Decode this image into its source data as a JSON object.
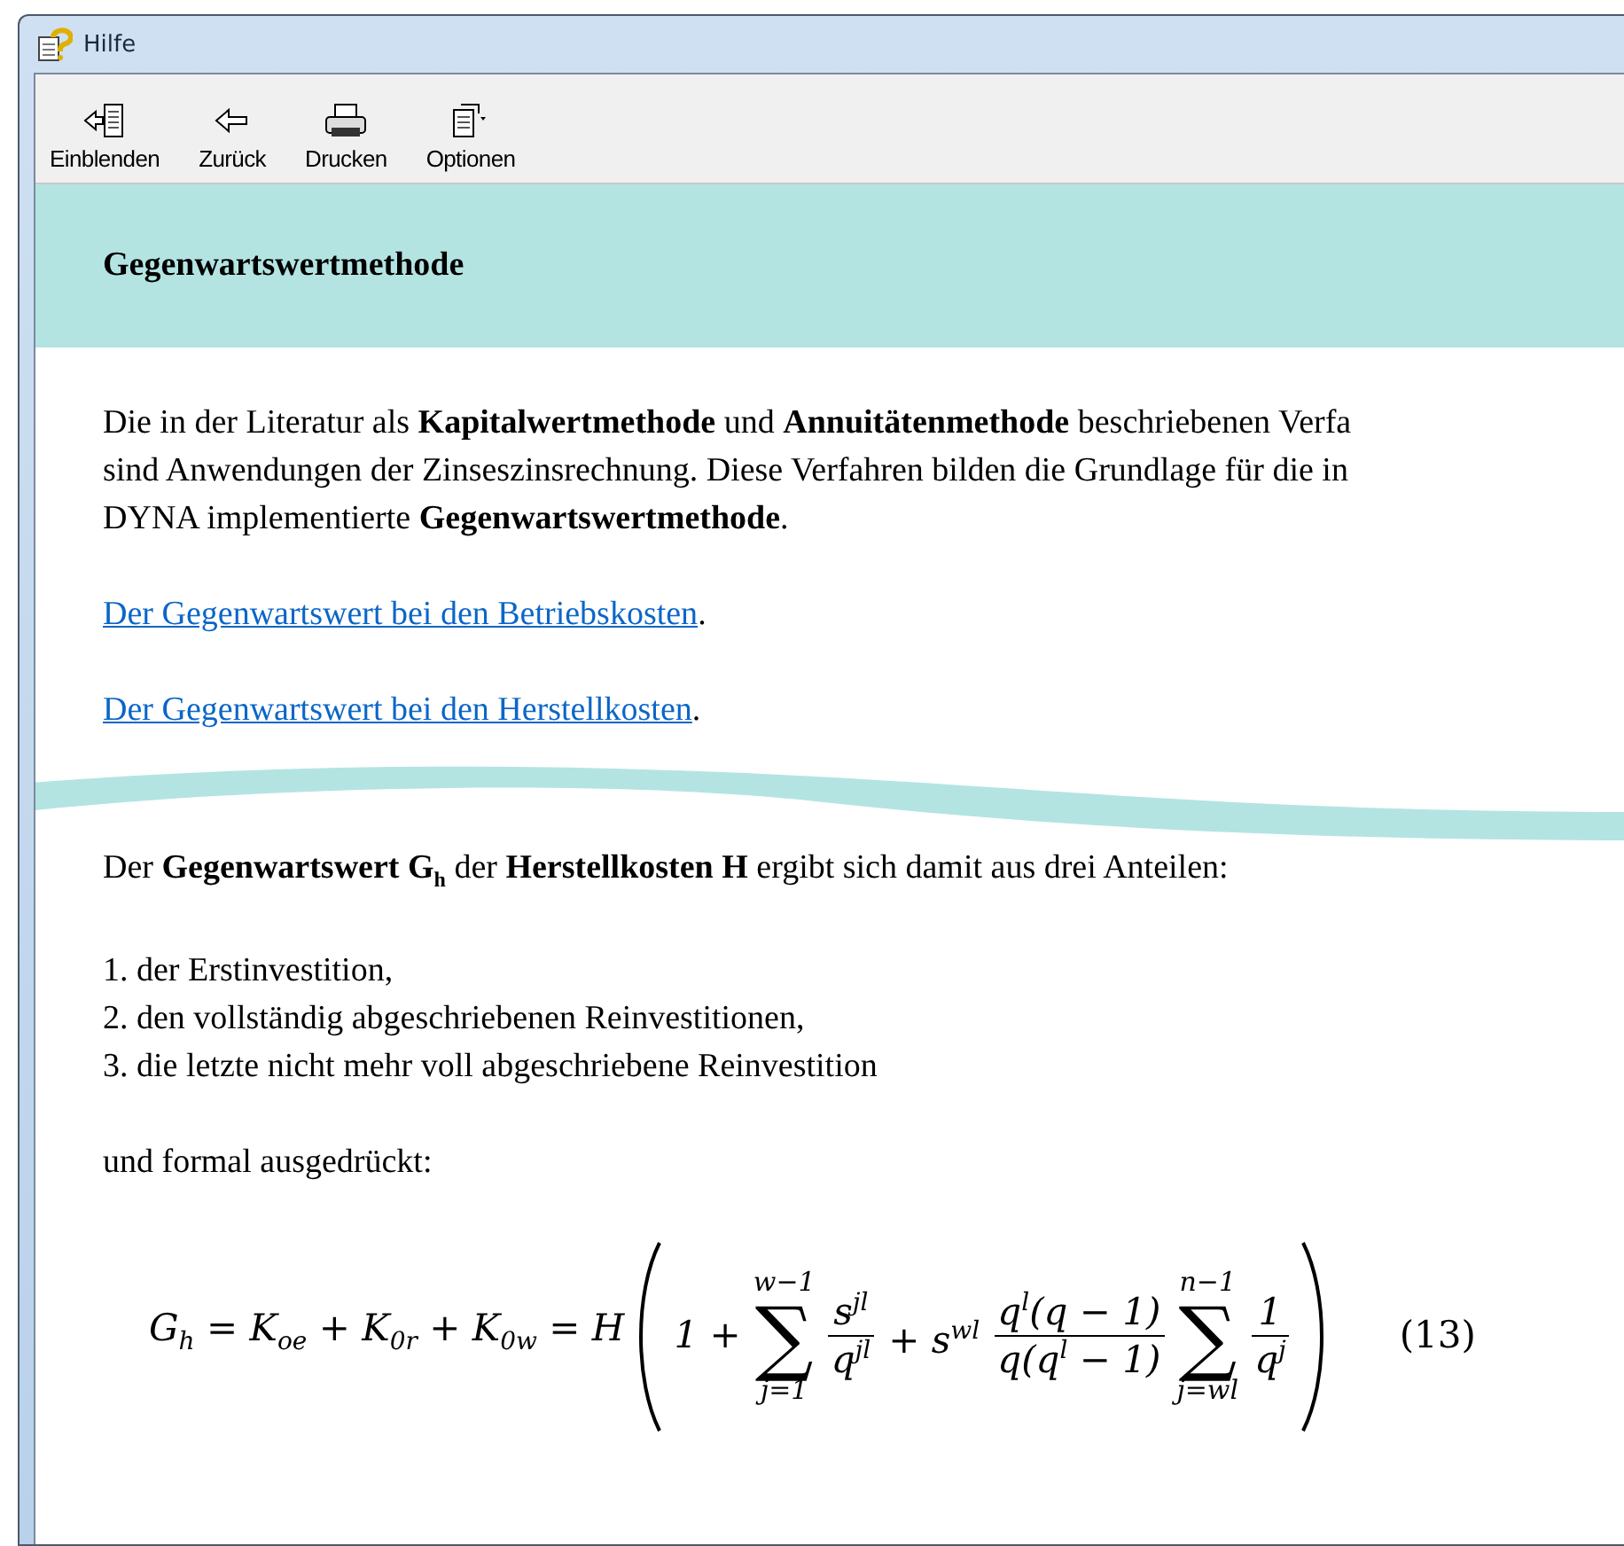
{
  "window": {
    "title": "Hilfe"
  },
  "toolbar": [
    {
      "label": "Einblenden",
      "kind": "show"
    },
    {
      "label": "Zurück",
      "kind": "back"
    },
    {
      "label": "Drucken",
      "kind": "print"
    },
    {
      "label": "Optionen",
      "kind": "options"
    }
  ],
  "topic": {
    "title": "Gegenwartswertmethode"
  },
  "intro": {
    "lines": [
      "Die in der Literatur als **Kapitalwertmethode** und **Annuitätenmethode** beschriebenen Verfa",
      "sind Anwendungen der Zinseszinsrechnung. Diese Verfahren bilden die Grundlage für die in",
      "DYNA implementierte **Gegenwartswertmethode**."
    ]
  },
  "links": [
    {
      "text": "Der Gegenwartswert bei den Betriebskosten",
      "after": "."
    },
    {
      "text": "Der Gegenwartswert bei den Herstellkosten",
      "after": "."
    }
  ],
  "after_cut": {
    "sentence": "Der **Gegenwartswert G**$_{h}$ der **Herstellkosten H** ergibt sich damit aus drei Anteilen:",
    "list": [
      "1. der Erstinvestition,",
      "2. den vollständig abgeschriebenen Reinvestitionen,",
      "3. die letzte nicht mehr voll abgeschriebene Reinvestition"
    ],
    "lead": "und formal ausgedrückt:"
  },
  "formula": {
    "lhs": "G$_{h}$ = K$_{oe}$ + K$_{0r}$ + K$_{0w}$ = H",
    "group": [
      {
        "kind": "text",
        "value": "1 +"
      },
      {
        "kind": "sum",
        "symbol": "∑",
        "upper": "w−1",
        "lower": "j=1"
      },
      {
        "kind": "frac",
        "num": "s$^{jl}$",
        "den": "q$^{jl}$"
      },
      {
        "kind": "text",
        "value": "+ s$^{wl}$"
      },
      {
        "kind": "frac",
        "num": "q$^{l}$(q − 1)",
        "den": "q(q$^{l}$ − 1)"
      },
      {
        "kind": "sum",
        "symbol": "∑",
        "upper": "n−1",
        "lower": "j=wl"
      },
      {
        "kind": "frac",
        "num": "1",
        "den": "q$^{j}$"
      }
    ],
    "number": "(13)"
  }
}
